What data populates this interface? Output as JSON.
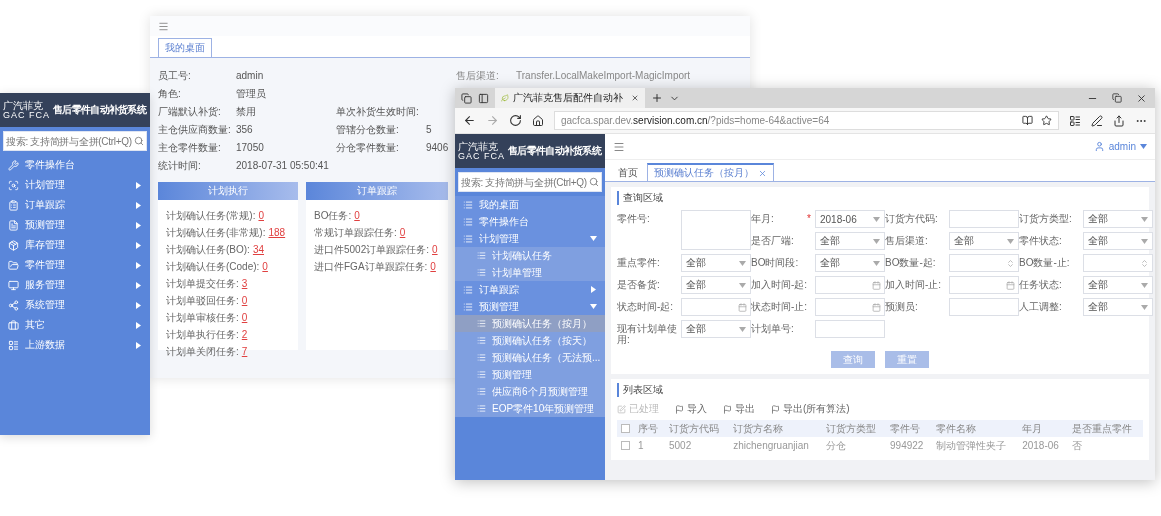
{
  "side_panel": {
    "logo": {
      "cn": "广汽菲克",
      "en": "GAC FCA"
    },
    "title": "售后零件自动补货系统",
    "search": {
      "placeholder": "搜索: 支持简拼与全拼(Ctrl+Q)"
    },
    "items": [
      {
        "label": "零件操作台",
        "expandable": false
      },
      {
        "label": "计划管理",
        "expandable": true
      },
      {
        "label": "订单跟踪",
        "expandable": true
      },
      {
        "label": "预测管理",
        "expandable": true
      },
      {
        "label": "库存管理",
        "expandable": true
      },
      {
        "label": "零件管理",
        "expandable": true
      },
      {
        "label": "服务管理",
        "expandable": true
      },
      {
        "label": "系统管理",
        "expandable": true
      },
      {
        "label": "其它",
        "expandable": true
      },
      {
        "label": "上游数据",
        "expandable": true
      }
    ]
  },
  "desktop_window": {
    "tab": {
      "label": "我的桌面",
      "selected": true
    },
    "info_left": [
      {
        "label": "员工号:",
        "value": "admin"
      },
      {
        "label": "角色:",
        "value": "管理员"
      },
      {
        "label": "厂端默认补货:",
        "value": "禁用"
      },
      {
        "label": "主仓供应商数量:",
        "value": "356"
      },
      {
        "label": "主仓零件数量:",
        "value": "17050"
      },
      {
        "label": "统计时间:",
        "value": "2018-07-31 05:50:41"
      }
    ],
    "info_middle": [
      {
        "label": "单次补货生效时间:"
      },
      {
        "label": "管辖分仓数量:",
        "value": "5"
      },
      {
        "label": "分仓零件数量:",
        "value": "9406"
      }
    ],
    "info_right": [
      {
        "label": "售后渠道:",
        "value": "Transfer.LocalMakeImport-MagicImport"
      }
    ],
    "cards": [
      {
        "title": "计划执行",
        "tasks": [
          {
            "label": "计划确认任务(常规):",
            "count": "0"
          },
          {
            "label": "计划确认任务(非常规):",
            "count": "188"
          },
          {
            "label": "计划确认任务(BO):",
            "count": "34"
          },
          {
            "label": "计划确认任务(Code):",
            "count": "0"
          },
          {
            "label": "计划单提交任务:",
            "count": "3"
          },
          {
            "label": "计划单驳回任务:",
            "count": "0"
          },
          {
            "label": "计划单审核任务:",
            "count": "0"
          },
          {
            "label": "计划单执行任务:",
            "count": "2"
          },
          {
            "label": "计划单关闭任务:",
            "count": "7"
          }
        ]
      },
      {
        "title": "订单跟踪",
        "tasks": [
          {
            "label": "BO任务:",
            "count": "0"
          },
          {
            "label": "常规订单跟踪任务:",
            "count": "0"
          },
          {
            "label": "进口件5002订单跟踪任务:",
            "count": "0"
          },
          {
            "label": "进口件FGA订单跟踪任务:",
            "count": "0"
          }
        ]
      }
    ]
  },
  "browser": {
    "tab_title": "广汽菲克售后配件自动补",
    "url": "gacfca.spar.dev.**servision.com.cn**/?pids=home-64&active=64",
    "app": {
      "logo": {
        "cn": "广汽菲克",
        "en": "GAC FCA"
      },
      "title": "售后零件自动补货系统",
      "search": {
        "placeholder": "搜索: 支持简拼与全拼(Ctrl+Q)"
      },
      "user": "admin",
      "menu": [
        {
          "label": "我的桌面",
          "kind": "link",
          "selected": false
        },
        {
          "label": "零件操作台",
          "kind": "link",
          "selected": false
        },
        {
          "label": "计划管理",
          "kind": "group",
          "selected": false,
          "expanded": true,
          "children": [
            {
              "label": "计划确认任务",
              "selected": false
            },
            {
              "label": "计划单管理",
              "selected": false
            }
          ]
        },
        {
          "label": "订单跟踪",
          "kind": "group",
          "selected": false,
          "expanded": false
        },
        {
          "label": "预测管理",
          "kind": "group",
          "selected": false,
          "expanded": true,
          "children": [
            {
              "label": "预测确认任务（按月）",
              "selected": true
            },
            {
              "label": "预测确认任务（按天）",
              "selected": false
            },
            {
              "label": "预测确认任务（无法预...",
              "selected": false
            },
            {
              "label": "预测管理",
              "selected": false
            },
            {
              "label": "供应商6个月预测管理",
              "selected": false
            },
            {
              "label": "EOP零件10年预测管理",
              "selected": false
            }
          ]
        }
      ],
      "tabs": [
        {
          "label": "首页",
          "selected": false,
          "closable": false
        },
        {
          "label": "预测确认任务（按月）",
          "selected": true,
          "closable": true
        }
      ],
      "search_area": {
        "title": "查询区域",
        "fields": [
          {
            "label": "零件号:",
            "kind": "textarea"
          },
          {
            "label": "年月:",
            "required_mark": "*",
            "kind": "select",
            "value": "2018-06"
          },
          {
            "label": "订货方代码:",
            "kind": "text"
          },
          {
            "label": "订货方类型:",
            "kind": "select",
            "value": "全部"
          },
          {
            "label": "是否厂端:",
            "kind": "select",
            "value": "全部"
          },
          {
            "label": "售后渠道:",
            "kind": "select",
            "value": "全部"
          },
          {
            "label": "零件状态:",
            "kind": "select",
            "value": "全部"
          },
          {
            "label": "重点零件:",
            "kind": "select",
            "value": "全部"
          },
          {
            "label": "BO时间段:",
            "kind": "select",
            "value": "全部"
          },
          {
            "label": "BO数量-起:",
            "kind": "number"
          },
          {
            "label": "BO数量-止:",
            "kind": "number"
          },
          {
            "label": "是否备货:",
            "kind": "select",
            "value": "全部"
          },
          {
            "label": "加入时间-起:",
            "kind": "date"
          },
          {
            "label": "加入时间-止:",
            "kind": "date"
          },
          {
            "label": "任务状态:",
            "kind": "select",
            "value": "全部"
          },
          {
            "label": "状态时间-起:",
            "kind": "date"
          },
          {
            "label": "状态时间-止:",
            "kind": "date"
          },
          {
            "label": "预测员:",
            "kind": "text"
          },
          {
            "label": "人工调整:",
            "kind": "select",
            "value": "全部"
          },
          {
            "label": "现有计划单使用:",
            "kind": "select",
            "value": "全部"
          },
          {
            "label": "计划单号:",
            "kind": "text"
          }
        ],
        "buttons": [
          "查询",
          "重置"
        ]
      },
      "list_area": {
        "title": "列表区域",
        "actions": [
          {
            "label": "已处理",
            "disabled": true
          },
          {
            "label": "导入",
            "disabled": false
          },
          {
            "label": "导出",
            "disabled": false
          },
          {
            "label": "导出(所有算法)",
            "disabled": false
          }
        ],
        "select_all": {
          "checked": false
        },
        "columns": [
          "序号",
          "订货方代码",
          "订货方名称",
          "订货方类型",
          "零件号",
          "零件名称",
          "年月",
          "是否重点零件"
        ],
        "rows": [
          {
            "checked": false,
            "cells": [
              "1",
              "5002",
              "zhichengruanjian",
              "分仓",
              "994922",
              "制动管弹性夹子",
              "2018-06",
              "否"
            ]
          }
        ]
      }
    }
  }
}
